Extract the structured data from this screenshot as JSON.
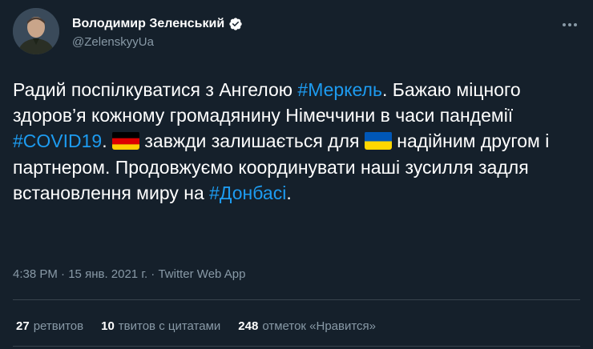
{
  "author": {
    "display_name": "Володимир Зеленський",
    "handle": "@ZelenskyyUa",
    "avatar": "avatar-photo",
    "verified_icon": "verified-badge-icon"
  },
  "more_icon": "more-options-icon",
  "tweet": {
    "line1_a": "Радий поспілкуватися з Ангелою ",
    "tag_merkel": "#Меркель",
    "line1_b": ". Бажаю міцного здоров’я кожному громадянину Німеччини в часи пандемії ",
    "tag_covid": "#COVID19",
    "line2_a": ". ",
    "line2_b": " завжди залишається для ",
    "line2_c": " надійним другом і партнером. Продовжуємо координувати наші зусилля задля встановлення миру на ",
    "tag_donbas": "#Донбасі",
    "end": ".",
    "flag_de": "germany-flag-icon",
    "flag_ua": "ukraine-flag-icon"
  },
  "meta": {
    "time": "4:38 PM",
    "sep1": " · ",
    "date": "15 янв. 2021 г.",
    "sep2": " · ",
    "source": "Twitter Web App"
  },
  "stats": {
    "retweets_count": "27",
    "retweets_label": "ретвитов",
    "quotes_count": "10",
    "quotes_label": "твитов с цитатами",
    "likes_count": "248",
    "likes_label": "отметок «Нравится»"
  },
  "colors": {
    "background": "#15202b",
    "link": "#1d9bf0",
    "secondary_text": "#8899a6",
    "divider": "#38444d"
  }
}
